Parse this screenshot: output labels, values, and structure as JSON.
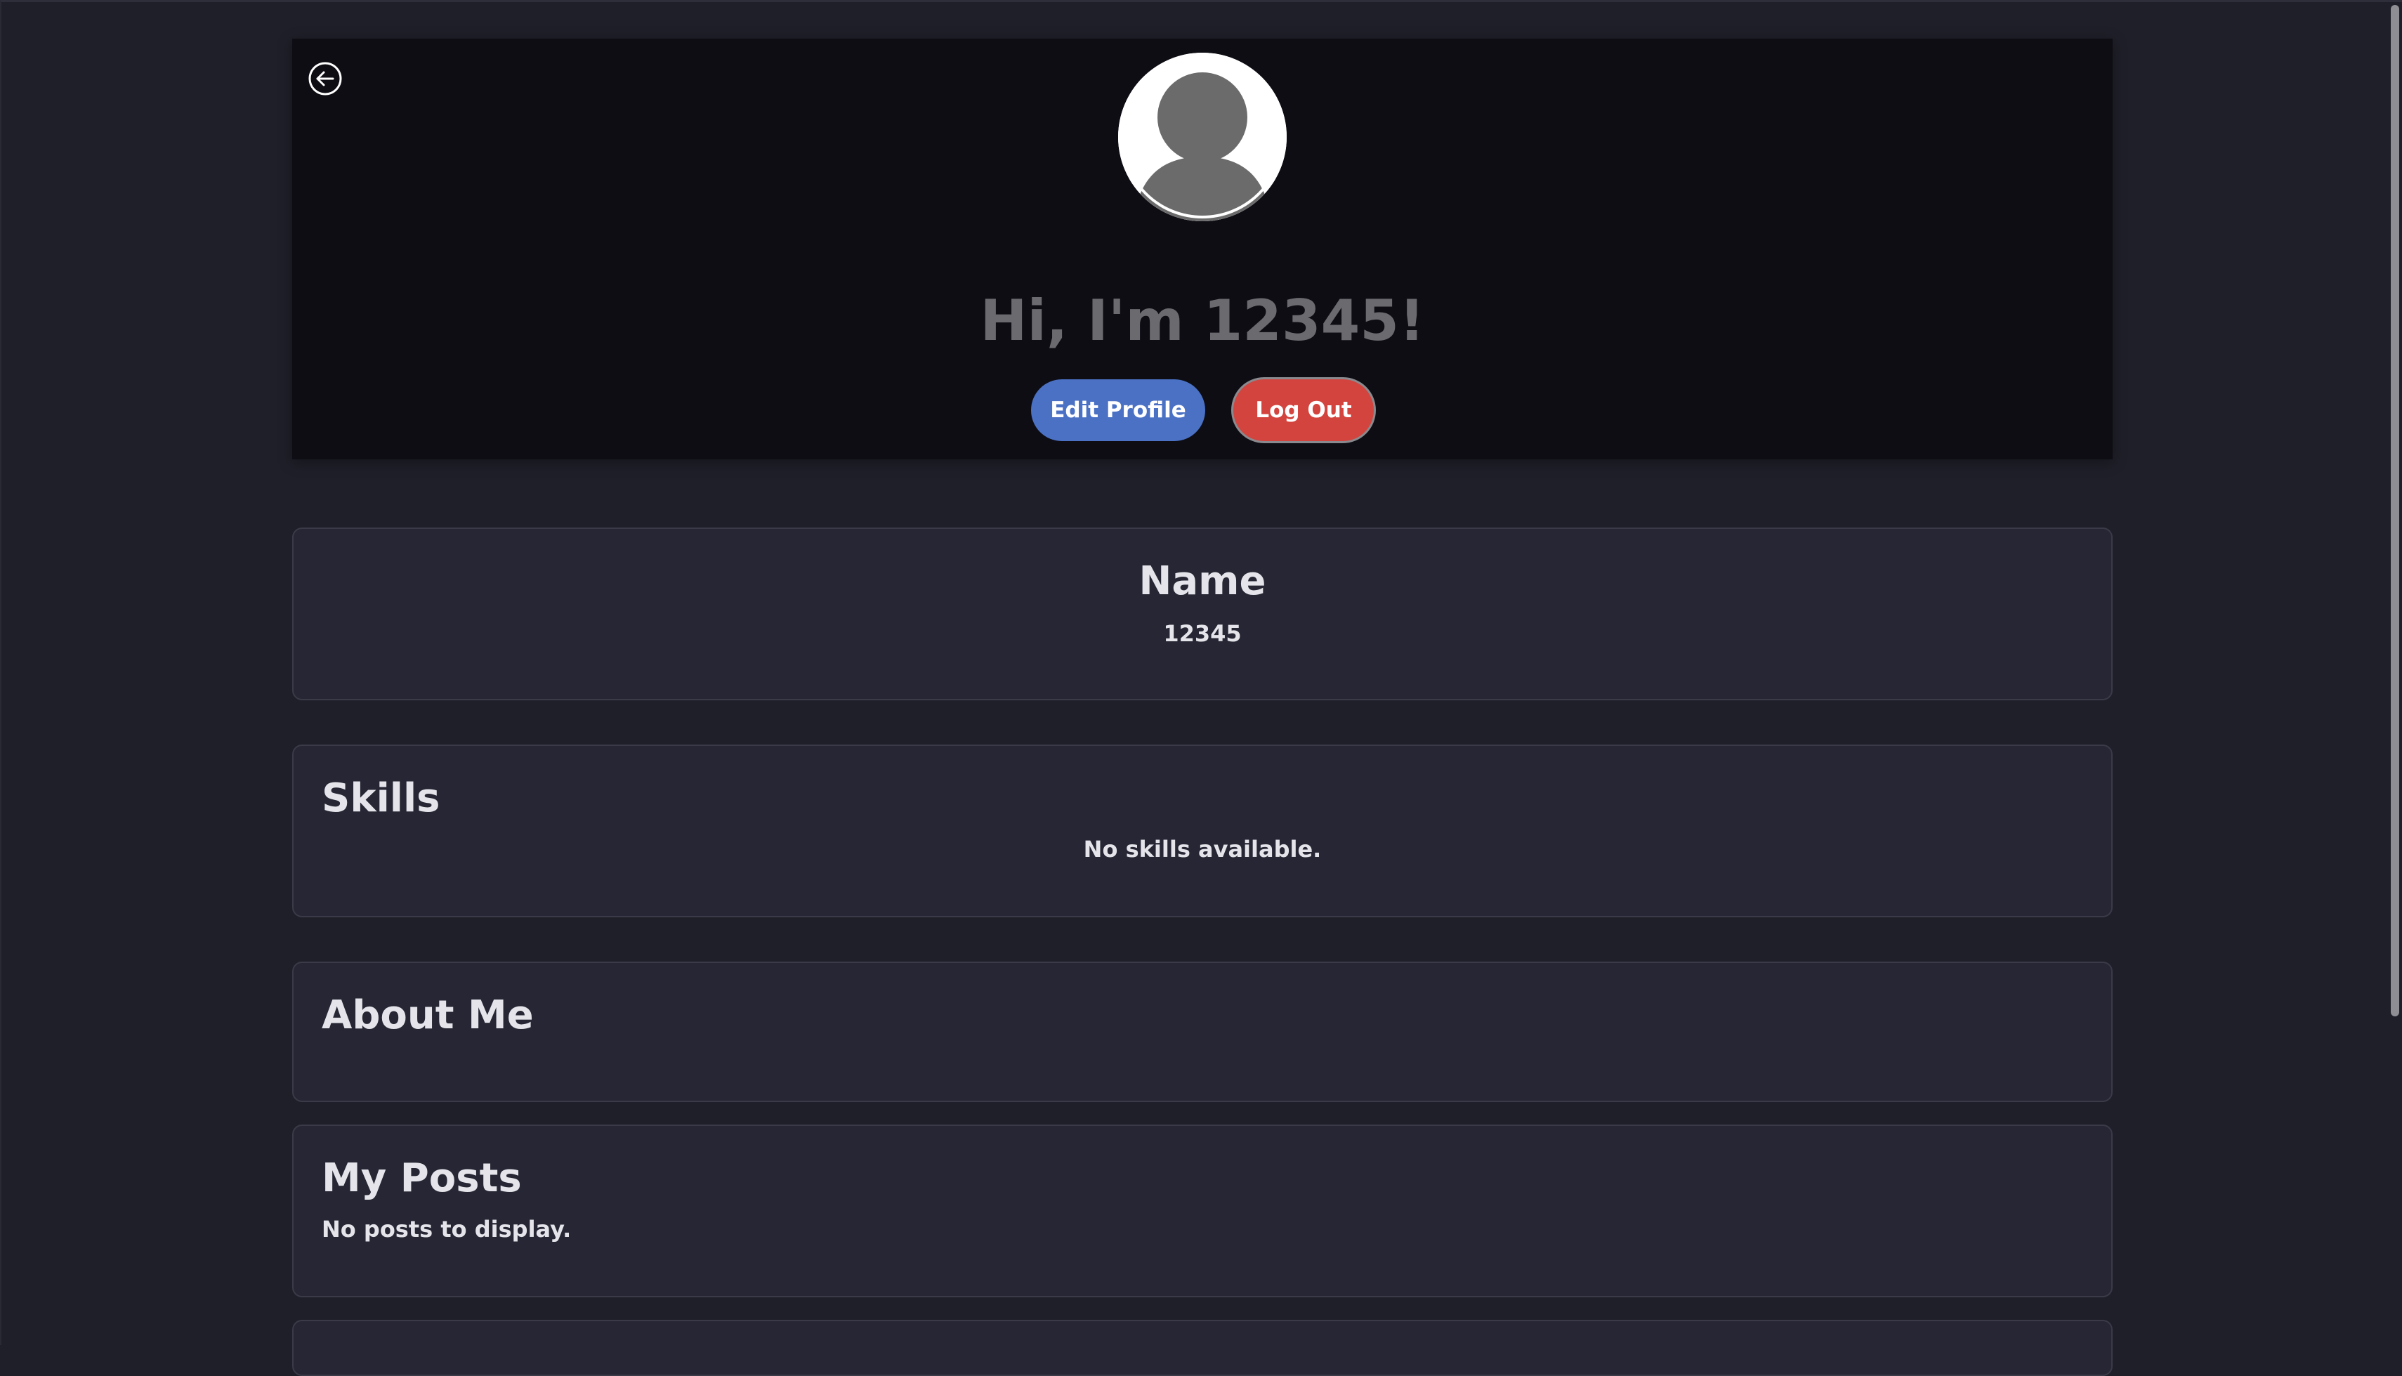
{
  "header": {
    "greeting": "Hi, I'm 12345!",
    "back_icon": "arrow-left-circle-icon",
    "avatar_icon": "default-user-avatar-icon",
    "edit_button": "Edit Profile",
    "logout_button": "Log Out"
  },
  "name_card": {
    "title": "Name",
    "value": "12345"
  },
  "skills_card": {
    "title": "Skills",
    "empty_text": "No skills available."
  },
  "about_card": {
    "title": "About Me"
  },
  "posts_card": {
    "title": "My Posts",
    "empty_text": "No posts to display."
  },
  "colors": {
    "page_bg": "#1f1f29",
    "header_bg": "#0e0d14",
    "card_bg": "#262634",
    "edit_button": "#4a71c4",
    "logout_button": "#d2443d",
    "greeting_text": "#6b6b6f"
  }
}
